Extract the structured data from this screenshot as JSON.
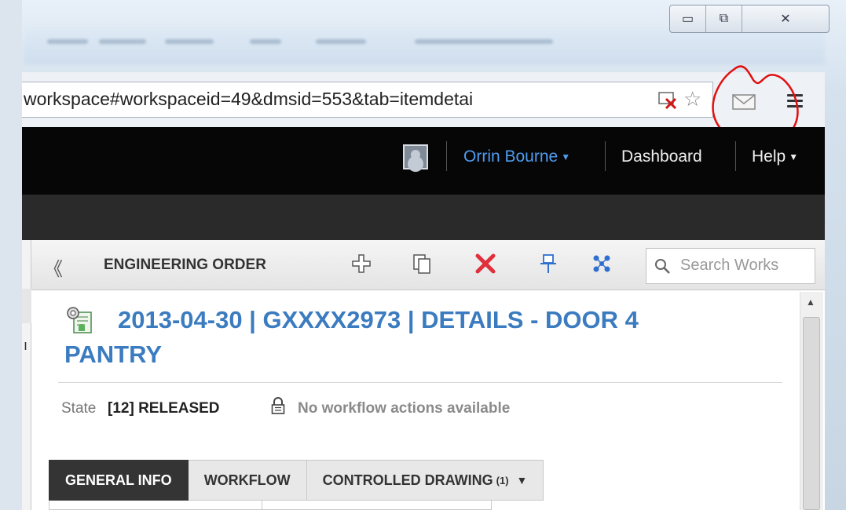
{
  "window": {
    "min_glyph": "▭",
    "max_glyph": "⧉",
    "close_glyph": "✕"
  },
  "browser": {
    "url": "workspace#workspaceid=49&dmsid=553&tab=itemdetai"
  },
  "header": {
    "user_name": "Orrin Bourne",
    "dashboard": "Dashboard",
    "help": "Help"
  },
  "toolbar": {
    "back_glyph": "《",
    "workspace_name": "ENGINEERING ORDER",
    "search_placeholder": "Search Works"
  },
  "left_pane": {
    "partial_char": "ı"
  },
  "item": {
    "title_line1": "2013-04-30 | GXXXX2973 | DETAILS - DOOR 4",
    "title_line2": "PANTRY",
    "state_label": "State",
    "state_value": "[12] RELEASED",
    "state_note": "No workflow actions available"
  },
  "tabs": [
    {
      "label": "GENERAL INFO"
    },
    {
      "label": "WORKFLOW"
    },
    {
      "label": "CONTROLLED DRAWING",
      "count": "(1)",
      "arrow": "▼"
    }
  ],
  "colors": {
    "link_blue": "#3b7bc0",
    "header_bg": "#060606",
    "annotation_red": "#e01010"
  }
}
